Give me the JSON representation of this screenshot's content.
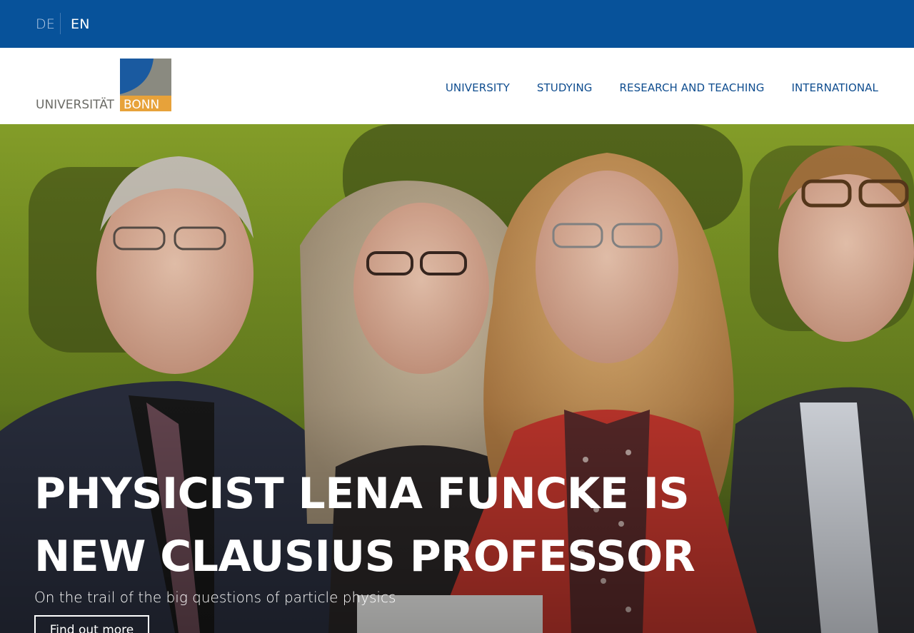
{
  "language_bar": {
    "languages": [
      {
        "code": "DE",
        "active": false
      },
      {
        "code": "EN",
        "active": true
      }
    ]
  },
  "header": {
    "logo": {
      "text_left": "UNIVERSITÄT",
      "text_right": "BONN",
      "colors": {
        "blue": "#1a5aa0",
        "gray": "#8a8a80",
        "orange": "#e7a23a"
      }
    },
    "nav": [
      {
        "label": "UNIVERSITY"
      },
      {
        "label": "STUDYING"
      },
      {
        "label": "RESEARCH AND TEACHING"
      },
      {
        "label": "INTERNATIONAL"
      }
    ]
  },
  "hero": {
    "image_alt": "four people smiling in front of a green moss wall",
    "title": "PHYSICIST LENA FUNCKE IS NEW CLAUSIUS PROFESSOR",
    "subtitle": "On the trail of the big questions of particle physics",
    "cta_label": "Find out more"
  },
  "colors": {
    "topbar": "#07529a",
    "nav_text": "#0f4d8f",
    "moss_green": "#7a9a1e"
  }
}
